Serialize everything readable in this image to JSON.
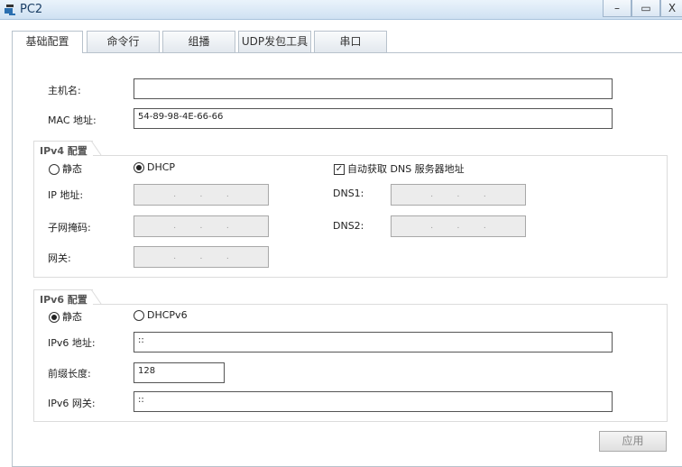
{
  "window": {
    "title": "PC2",
    "minimize": "–",
    "maximize": "▭",
    "close": "X"
  },
  "tabs": [
    "基础配置",
    "命令行",
    "组播",
    "UDP发包工具",
    "串口"
  ],
  "basic": {
    "hostname_label": "主机名:",
    "hostname_value": "",
    "mac_label": "MAC 地址:",
    "mac_value": "54-89-98-4E-66-66"
  },
  "ipv4": {
    "title": "IPv4 配置",
    "static_label": "静态",
    "dhcp_label": "DHCP",
    "mode": "DHCP",
    "auto_dns_label": "自动获取 DNS 服务器地址",
    "auto_dns_checked": true,
    "ip_label": "IP 地址:",
    "mask_label": "子网掩码:",
    "gateway_label": "网关:",
    "dns1_label": "DNS1:",
    "dns2_label": "DNS2:",
    "ip_dots": ". . ."
  },
  "ipv6": {
    "title": "IPv6 配置",
    "static_label": "静态",
    "dhcp_label": "DHCPv6",
    "mode": "静态",
    "addr_label": "IPv6 地址:",
    "addr_value": "::",
    "prefix_label": "前缀长度:",
    "prefix_value": "128",
    "gateway_label": "IPv6 网关:",
    "gateway_value": "::"
  },
  "apply_label": "应用"
}
